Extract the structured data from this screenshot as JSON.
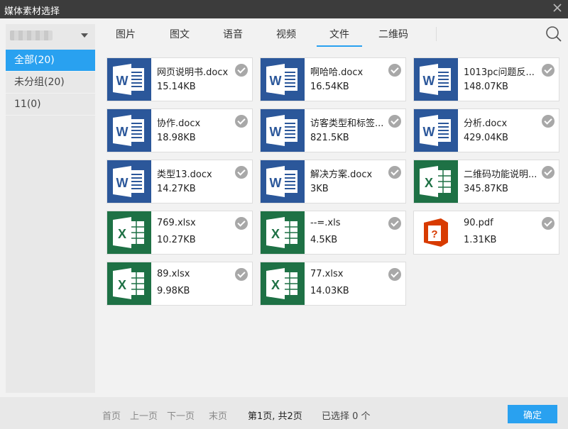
{
  "window": {
    "title": "媒体素材选择"
  },
  "sidebar": {
    "groups": [
      {
        "label": "全部(20)",
        "active": true
      },
      {
        "label": "未分组(20)",
        "active": false
      },
      {
        "label": "11(0)",
        "active": false
      }
    ]
  },
  "tabs": [
    {
      "label": "图片",
      "active": false
    },
    {
      "label": "图文",
      "active": false
    },
    {
      "label": "语音",
      "active": false
    },
    {
      "label": "视频",
      "active": false
    },
    {
      "label": "文件",
      "active": true
    },
    {
      "label": "二维码",
      "active": false
    }
  ],
  "files": [
    {
      "name": "网页说明书.docx",
      "size": "15.14KB",
      "type": "word"
    },
    {
      "name": "啊哈哈.docx",
      "size": "16.54KB",
      "type": "word"
    },
    {
      "name": "1013pc问题反...",
      "size": "148.07KB",
      "type": "word"
    },
    {
      "name": "协作.docx",
      "size": "18.98KB",
      "type": "word"
    },
    {
      "name": "访客类型和标签...",
      "size": "821.5KB",
      "type": "word"
    },
    {
      "name": "分析.docx",
      "size": "429.04KB",
      "type": "word"
    },
    {
      "name": "类型13.docx",
      "size": "14.27KB",
      "type": "word"
    },
    {
      "name": "解决方案.docx",
      "size": "3KB",
      "type": "word"
    },
    {
      "name": "二维码功能说明...",
      "size": "345.87KB",
      "type": "excel"
    },
    {
      "name": "769.xlsx",
      "size": "10.27KB",
      "type": "excel"
    },
    {
      "name": "--=.xls",
      "size": "4.5KB",
      "type": "excel"
    },
    {
      "name": "90.pdf",
      "size": "1.31KB",
      "type": "pdf"
    },
    {
      "name": "89.xlsx",
      "size": "9.98KB",
      "type": "excel"
    },
    {
      "name": "77.xlsx",
      "size": "14.03KB",
      "type": "excel"
    }
  ],
  "footer": {
    "first": "首页",
    "prev": "上一页",
    "next": "下一页",
    "last": "末页",
    "page_info": "第1页, 共2页",
    "selected": "已选择 0 个",
    "confirm": "确定"
  },
  "colors": {
    "accent": "#29a1f0",
    "word": "#2b579a",
    "excel": "#1e7145",
    "pdf": "#d83b01",
    "titlebar": "#3c3c3c"
  }
}
